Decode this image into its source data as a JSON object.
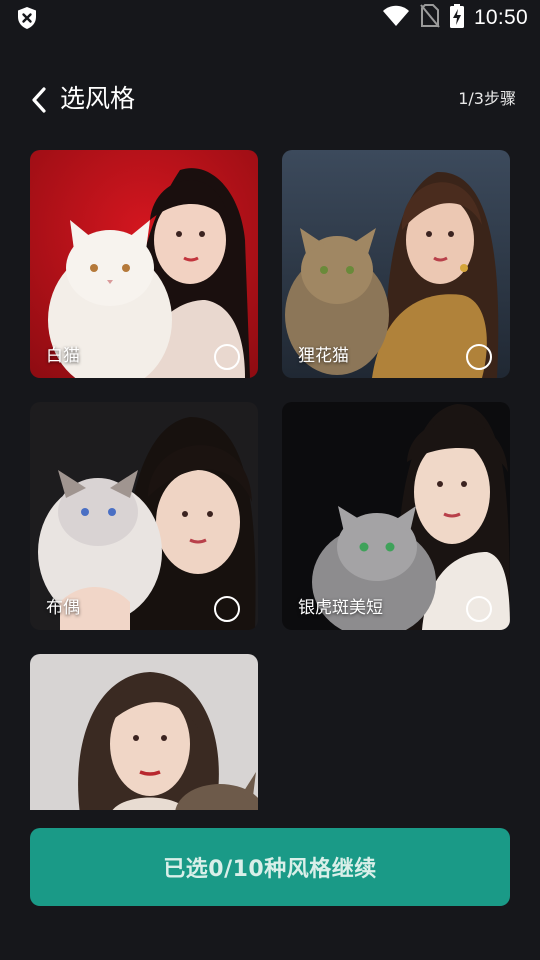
{
  "status_bar": {
    "time": "10:50",
    "icons": [
      "shield-x-icon",
      "wifi-icon",
      "no-sim-icon",
      "battery-charging-icon"
    ]
  },
  "header": {
    "back_icon": "chevron-left-icon",
    "title": "选风格",
    "step": "1/3步骤"
  },
  "styles": [
    {
      "label": "白猫",
      "selected": false
    },
    {
      "label": "狸花猫",
      "selected": false
    },
    {
      "label": "布偶",
      "selected": false
    },
    {
      "label": "银虎斑美短",
      "selected": false
    },
    {
      "label": "",
      "selected": false
    }
  ],
  "continue_button": {
    "label": "已选0/10种风格继续"
  },
  "colors": {
    "background": "#16171b",
    "accent": "#1a9a87"
  }
}
